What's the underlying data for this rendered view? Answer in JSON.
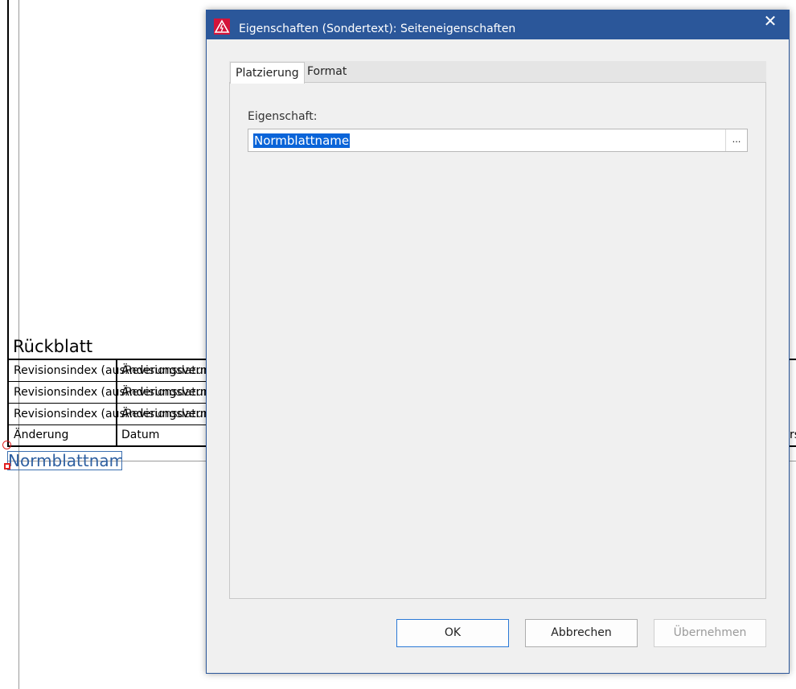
{
  "background": {
    "sheet_title": "Rückblatt",
    "revision_rows": [
      {
        "col1": "Revisionsindex (aus",
        "col2_a": "Änderungsvermerk",
        "col2_b": "Revisionsdatum"
      },
      {
        "col1": "Revisionsindex (aus",
        "col2_a": "Änderungsvermerk",
        "col2_b": "Revisionsdatum"
      },
      {
        "col1": "Revisionsindex (aus",
        "col2_a": "Änderungsvermerk",
        "col2_b": "Revisionsdatum"
      }
    ],
    "header_row": {
      "col1": "Änderung",
      "col2": "Datum",
      "col_right": "rs"
    },
    "selected_text": "Normblattname",
    "accent_color": "#2e5fa0",
    "marker_color": "#e02020"
  },
  "dialog": {
    "title": "Eigenschaften (Sondertext): Seiteneigenschaften",
    "close_glyph": "✕",
    "tabs": [
      {
        "label": "Platzierung",
        "active": true
      },
      {
        "label": "Format",
        "active": false
      }
    ],
    "property": {
      "label": "Eigenschaft:",
      "value": "Normblattname",
      "browse_label": "..."
    },
    "buttons": {
      "ok": "OK",
      "cancel": "Abbrechen",
      "apply": "Übernehmen"
    },
    "titlebar_color": "#2b579a"
  }
}
